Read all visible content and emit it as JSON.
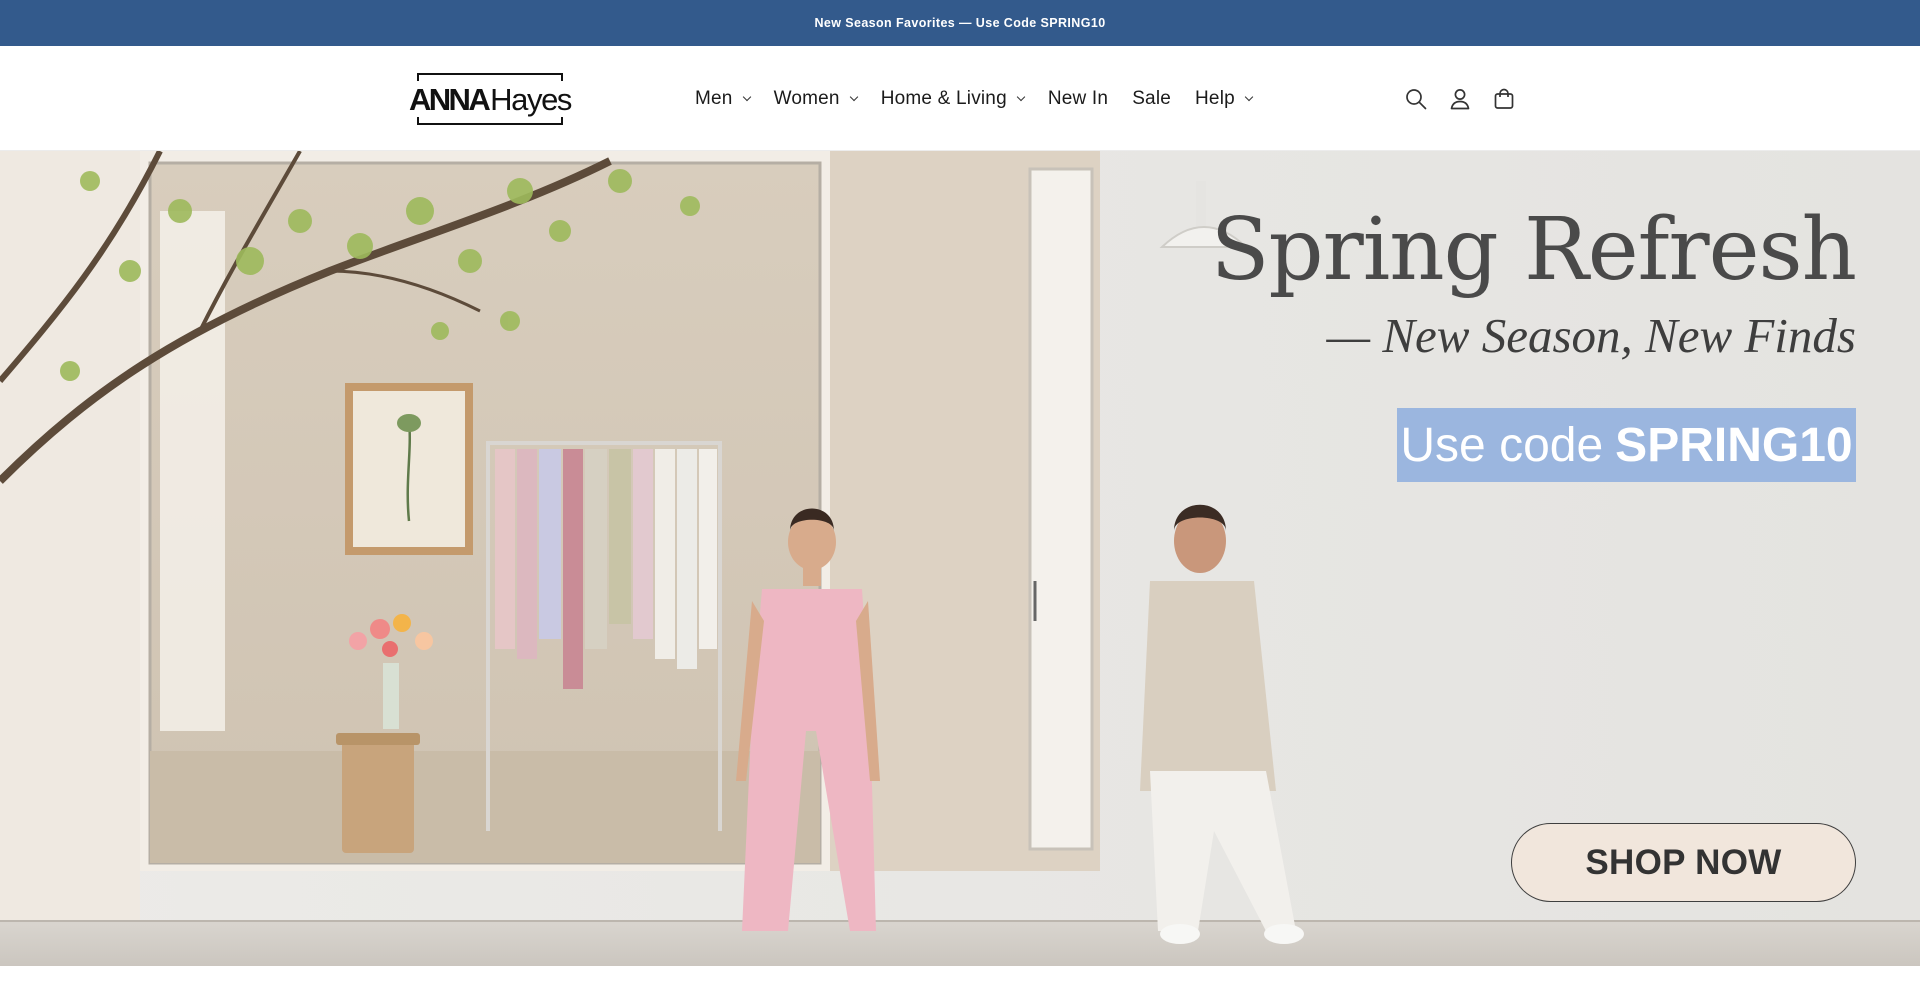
{
  "announcement": {
    "text": "New Season Favorites — Use Code SPRING10"
  },
  "brand": {
    "logo_bold": "ANNA",
    "logo_light": "Hayes"
  },
  "nav": {
    "items": [
      {
        "label": "Men",
        "has_dropdown": true
      },
      {
        "label": "Women",
        "has_dropdown": true
      },
      {
        "label": "Home & Living",
        "has_dropdown": true
      },
      {
        "label": "New In",
        "has_dropdown": false
      },
      {
        "label": "Sale",
        "has_dropdown": false
      },
      {
        "label": "Help",
        "has_dropdown": true
      }
    ]
  },
  "header_icons": [
    "search-icon",
    "account-icon",
    "cart-icon"
  ],
  "hero": {
    "title": "Spring Refresh",
    "subtitle": "— New Season, New Finds",
    "code_prefix": "Use code",
    "code": "SPRING10",
    "cta": "SHOP NOW"
  },
  "colors": {
    "announcement_bg": "#335a8c",
    "code_badge_bg": "#9bb6df",
    "cta_bg": "#f1e6dc",
    "title_text": "#4a4a4a"
  }
}
